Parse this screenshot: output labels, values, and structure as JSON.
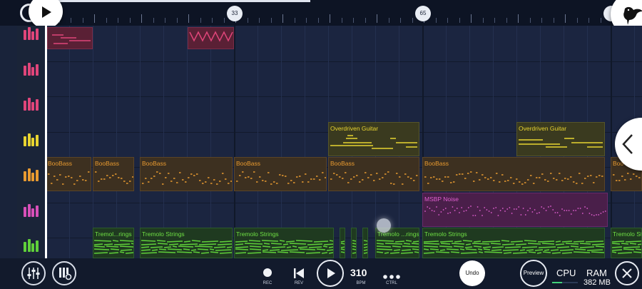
{
  "ruler": {
    "marker_33": "33",
    "marker_65": "65"
  },
  "tracks": [
    {
      "name": "track-icon-1",
      "color": "#e0457a"
    },
    {
      "name": "track-icon-2",
      "color": "#e0457a"
    },
    {
      "name": "track-icon-3",
      "color": "#e0457a"
    },
    {
      "name": "track-icon-4",
      "color": "#e8d430"
    },
    {
      "name": "track-icon-5",
      "color": "#e89a30"
    },
    {
      "name": "track-icon-6",
      "color": "#d84fb8"
    },
    {
      "name": "track-icon-7",
      "color": "#5fd03a"
    }
  ],
  "clips": {
    "overdriven_1": "Overdriven Guitar",
    "overdriven_2": "Overdriven Guitar",
    "boobass_1": "BooBass",
    "boobass_2": "BooBass",
    "boobass_3": "BooBass",
    "boobass_4": "BooBass",
    "boobass_5": "BooBass",
    "boobass_6": "BooBass",
    "boobass_7": "Boo",
    "msbp": "MSBP Noise",
    "tremolo_1": "Tremol...rings",
    "tremolo_2": "Tremolo Strings",
    "tremolo_3": "Tremolo Strings",
    "tremolo_4": "Tremolo ...rings",
    "tremolo_5": "Tremolo Strings",
    "tremolo_6": "Tremolo Str"
  },
  "transport": {
    "rec_label": "REC",
    "rev_label": "REV",
    "bpm_value": "310",
    "bpm_label": "BPM",
    "ctrl_label": "CTRL",
    "undo_label": "Undo",
    "preview_label": "Preview",
    "cpu_label": "CPU",
    "ram_label": "RAM",
    "ram_value": "382 MB"
  },
  "colors": {
    "pink": "#e0457a",
    "yellow": "#e8d430",
    "orange": "#e89a30",
    "magenta": "#d84fb8",
    "green": "#5fd03a"
  }
}
